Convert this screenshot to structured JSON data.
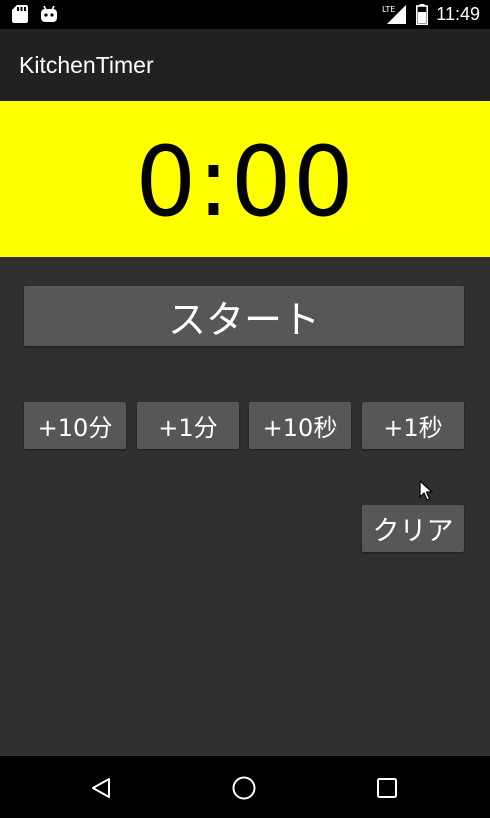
{
  "status_bar": {
    "time": "11:49",
    "network_label": "LTE",
    "icons": [
      "sd-card-icon",
      "android-icon",
      "signal-icon",
      "battery-icon"
    ]
  },
  "app": {
    "title": "KitchenTimer"
  },
  "timer": {
    "display": "0:00",
    "panel_color": "#ffff00"
  },
  "buttons": {
    "start_label": "スタート",
    "plus10min_label": "+10分",
    "plus1min_label": "+1分",
    "plus10sec_label": "+10秒",
    "plus1sec_label": "+1秒",
    "clear_label": "クリア"
  },
  "nav_bar": {
    "icons": [
      "back-icon",
      "home-icon",
      "recents-icon"
    ]
  },
  "colors": {
    "background": "#303030",
    "app_bar": "#212121",
    "button": "#575757",
    "timer_panel": "#ffff00"
  }
}
